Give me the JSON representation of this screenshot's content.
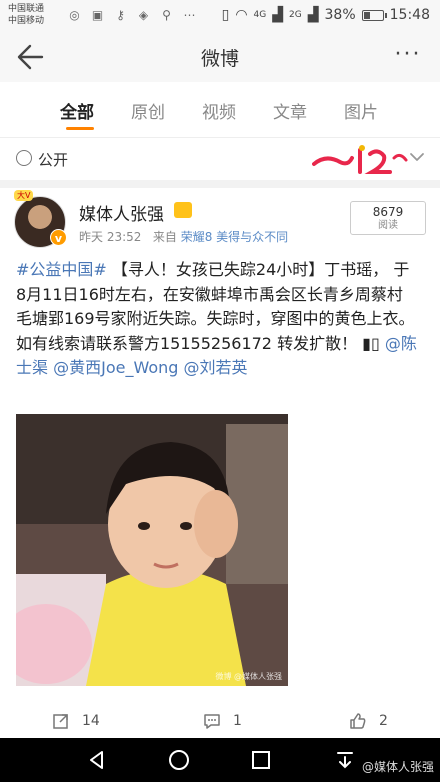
{
  "status_bar": {
    "carrier_1": "中国联通",
    "carrier_2": "中国移动",
    "network_1": "4G",
    "network_2": "2G",
    "battery": "38%",
    "battery_level": 0.38,
    "time": "15:48"
  },
  "titlebar": {
    "title": "微博",
    "back_icon": "back-arrow-icon",
    "more_icon": "more-dots-icon",
    "more_label": "···"
  },
  "tabs": [
    {
      "label": "全部",
      "active": true
    },
    {
      "label": "原创",
      "active": false
    },
    {
      "label": "视频",
      "active": false
    },
    {
      "label": "文章",
      "active": false
    },
    {
      "label": "图片",
      "active": false
    }
  ],
  "filter": {
    "label": "公开"
  },
  "post": {
    "username": "媒体人张强",
    "avatar_tag": "大V",
    "vbadge": "v",
    "time": "昨天 23:52",
    "source_prefix": "来自",
    "source": "荣耀8 美得与众不同",
    "read_count": "8679",
    "read_label": "阅读",
    "text_parts": {
      "hashtag": "#公益中国#",
      "body": " 【寻人！女孩已失踪24小时】丁书瑶， 于8月11日16时左右，在安徽蚌埠市禹会区长青乡周蔡村毛塘郢169号家附近失踪。失踪时，穿图中的黄色上衣。如有线索请联系警方15155256172  转发扩散！",
      "mention_1": "@陈士渠",
      "mention_2": "@黄西Joe_Wong",
      "mention_3": "@刘若英"
    },
    "image_watermark": "微博 @媒体人张强",
    "reposts": "14",
    "comments": "1",
    "likes": "2"
  },
  "navbar": {
    "watermark": "@媒体人张强"
  },
  "colors": {
    "accent": "#ff8200",
    "link": "#4a77b6"
  }
}
